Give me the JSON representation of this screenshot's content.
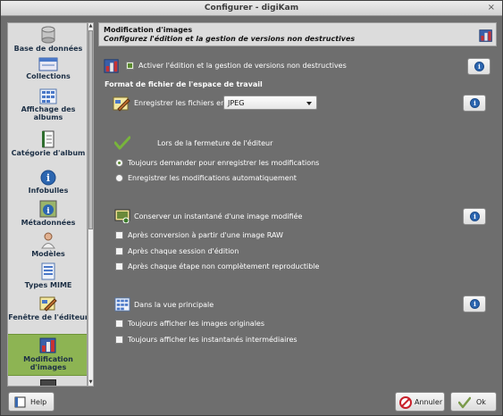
{
  "window": {
    "title": "Configurer - digiKam",
    "close_symbol": "×"
  },
  "sidebar": {
    "items": [
      {
        "label": "Base de données",
        "icon": "database-icon"
      },
      {
        "label": "Collections",
        "icon": "collections-icon"
      },
      {
        "label": "Affichage des albums",
        "icon": "album-view-icon"
      },
      {
        "label": "Catégorie d'album",
        "icon": "album-category-icon"
      },
      {
        "label": "Infobulles",
        "icon": "info-icon"
      },
      {
        "label": "Métadonnées",
        "icon": "metadata-icon"
      },
      {
        "label": "Modèles",
        "icon": "templates-icon"
      },
      {
        "label": "Types MIME",
        "icon": "mime-types-icon"
      },
      {
        "label": "Fenêtre de l'éditeur",
        "icon": "editor-window-icon"
      },
      {
        "label": "Modification d'images",
        "icon": "image-editing-icon",
        "selected": true
      }
    ]
  },
  "header": {
    "title": "Modification d'images",
    "subtitle": "Configurez l'édition et la gestion de versions non destructives"
  },
  "main": {
    "enable_versioning": {
      "label": "Activer l'édition et la gestion de versions non destructives",
      "checked": true
    },
    "workspace_format_title": "Format de fichier de l'espace de travail",
    "save_files_label": "Enregistrer les fichiers en",
    "format_value": "JPEG",
    "on_close_label": "Lors de la fermeture de l'éditeur",
    "radio_always_ask": {
      "label": "Toujours demander pour enregistrer les modifications",
      "checked": true
    },
    "radio_auto_save": {
      "label": "Enregistrer les modifications automatiquement",
      "checked": false
    },
    "snapshot_label": "Conserver un instantané d'une image modifiée",
    "snapshot_after_raw": {
      "label": "Après conversion à partir d'une image RAW",
      "checked": false
    },
    "snapshot_after_session": {
      "label": "Après chaque session d'édition",
      "checked": false
    },
    "snapshot_after_step": {
      "label": "Après chaque étape non complètement reproductible",
      "checked": false
    },
    "main_view_label": "Dans la vue principale",
    "show_originals": {
      "label": "Toujours afficher les images originales",
      "checked": false
    },
    "show_snapshots": {
      "label": "Toujours afficher les instantanés intermédiaires",
      "checked": false
    },
    "info_symbol": "i"
  },
  "footer": {
    "help_label": "Help",
    "cancel_label": "Annuler",
    "ok_label": "Ok"
  },
  "colors": {
    "selected_item": "#8db453",
    "info_button": "#2c66b0",
    "cancel_icon": "#c8202a",
    "check_green": "#5b8a2f"
  }
}
